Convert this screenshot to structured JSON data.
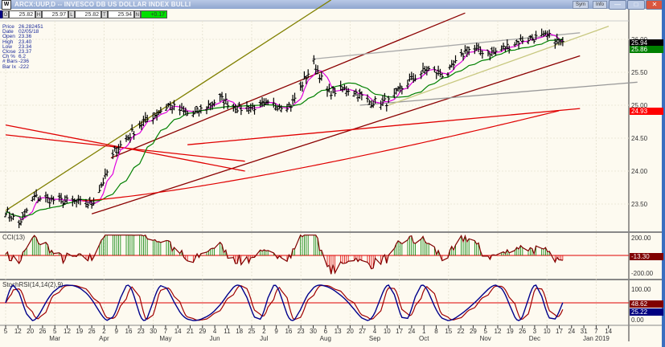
{
  "window": {
    "title": "ARCX:UUP,D -- INVESCO DB US DOLLAR INDEX BULLI",
    "buttons": {
      "sym": "Sym",
      "info": "Info",
      "minimize": "—",
      "maximize": "□",
      "close": "✕"
    }
  },
  "quote_bar": {
    "open_key": "O",
    "open": "25.82",
    "high_key": "H",
    "high": "25.97",
    "low_key": "L",
    "low": "25.82",
    "last_key": "T",
    "last": "25.94",
    "net_key": "N",
    "net": "+0.17",
    "net_color": "#00e000"
  },
  "info_box": [
    {
      "label": "Price",
      "value": "26.282451"
    },
    {
      "label": "Date",
      "value": "02/05/18"
    },
    {
      "label": "Open",
      "value": "23.36"
    },
    {
      "label": "High",
      "value": "23.40"
    },
    {
      "label": "Low",
      "value": "23.34"
    },
    {
      "label": "Close",
      "value": "23.37"
    },
    {
      "label": "Ch %",
      "value": "6.2"
    },
    {
      "label": "# Bars",
      "value": "-236"
    },
    {
      "label": "Bar Ix",
      "value": "-222"
    }
  ],
  "price_axis": {
    "ticks": [
      "26.00",
      "25.50",
      "25.00",
      "24.50",
      "24.00",
      "23.50"
    ],
    "tick_values": [
      26.0,
      25.5,
      25.0,
      24.5,
      24.0,
      23.5
    ],
    "markers": [
      {
        "value": "25.94",
        "price": 25.94,
        "color": "#000000"
      },
      {
        "value": "25.86",
        "price": 25.86,
        "color": "#008000"
      },
      {
        "value": "24.93",
        "price": 24.93,
        "color": "#ff0000"
      }
    ]
  },
  "cci": {
    "title": "CCI(13)",
    "ticks": [
      "200.00",
      "-200.00"
    ],
    "marker": {
      "value": "-13.30",
      "color": "#800000"
    }
  },
  "stochrsi": {
    "title": "StochRSI(14,14(2),9)",
    "ticks": [
      "100.00",
      "0.00"
    ],
    "markers": [
      {
        "value": "48.62",
        "color": "#800000"
      },
      {
        "value": "25.22",
        "color": "#000080"
      }
    ]
  },
  "date_axis": {
    "days": [
      "5",
      "12",
      "20",
      "26",
      "5",
      "12",
      "19",
      "26",
      "2",
      "9",
      "16",
      "23",
      "30",
      "7",
      "14",
      "21",
      "29",
      "4",
      "11",
      "18",
      "25",
      "2",
      "9",
      "16",
      "23",
      "30",
      "6",
      "13",
      "20",
      "27",
      "4",
      "10",
      "17",
      "24",
      "1",
      "8",
      "15",
      "22",
      "29",
      "5",
      "12",
      "19",
      "26",
      "3",
      "10",
      "17",
      "24",
      "31",
      "7",
      "14"
    ],
    "months": [
      {
        "label": "Mar",
        "at": 4
      },
      {
        "label": "Apr",
        "at": 8
      },
      {
        "label": "May",
        "at": 13
      },
      {
        "label": "Jun",
        "at": 17
      },
      {
        "label": "Jul",
        "at": 21
      },
      {
        "label": "Aug",
        "at": 26
      },
      {
        "label": "Sep",
        "at": 30
      },
      {
        "label": "Oct",
        "at": 34
      },
      {
        "label": "Nov",
        "at": 39
      },
      {
        "label": "Dec",
        "at": 43
      },
      {
        "label": "Jan 2019",
        "at": 48
      }
    ]
  },
  "chart_data": {
    "type": "ohlc",
    "x_unit": "days since Mar 5 2018",
    "x_range": [
      0,
      315
    ],
    "y_range": [
      23.2,
      26.1
    ],
    "price_path": [
      [
        0,
        23.4
      ],
      [
        7,
        23.2
      ],
      [
        15,
        23.6
      ],
      [
        28,
        23.55
      ],
      [
        45,
        23.5
      ],
      [
        52,
        23.9
      ],
      [
        57,
        24.3
      ],
      [
        70,
        24.7
      ],
      [
        85,
        25.0
      ],
      [
        97,
        24.85
      ],
      [
        112,
        25.1
      ],
      [
        122,
        24.95
      ],
      [
        137,
        25.0
      ],
      [
        149,
        25.0
      ],
      [
        161,
        25.65
      ],
      [
        168,
        25.2
      ],
      [
        180,
        25.25
      ],
      [
        190,
        25.05
      ],
      [
        200,
        25.05
      ],
      [
        210,
        25.35
      ],
      [
        220,
        25.55
      ],
      [
        230,
        25.45
      ],
      [
        241,
        25.85
      ],
      [
        255,
        25.8
      ],
      [
        270,
        26.0
      ],
      [
        283,
        26.05
      ],
      [
        291,
        25.92
      ]
    ],
    "trendlines": [
      {
        "color": "#8b0000",
        "pts": [
          [
            45,
            23.35
          ],
          [
            300,
            25.75
          ]
        ]
      },
      {
        "color": "#8b0000",
        "pts": [
          [
            55,
            24.2
          ],
          [
            240,
            26.4
          ]
        ]
      },
      {
        "color": "#808000",
        "pts": [
          [
            0,
            23.4
          ],
          [
            170,
            26.6
          ]
        ]
      },
      {
        "color": "#e00000",
        "pts": [
          [
            0,
            24.7
          ],
          [
            125,
            24.0
          ]
        ]
      },
      {
        "color": "#e00000",
        "pts": [
          [
            0,
            24.55
          ],
          [
            125,
            24.15
          ]
        ]
      },
      {
        "color": "#999999",
        "pts": [
          [
            185,
            25.0
          ],
          [
            330,
            25.35
          ]
        ]
      },
      {
        "color": "#aaaaaa",
        "pts": [
          [
            160,
            25.7
          ],
          [
            300,
            26.1
          ]
        ]
      },
      {
        "color": "#c8c880",
        "pts": [
          [
            200,
            25.0
          ],
          [
            315,
            26.2
          ]
        ]
      },
      {
        "color": "#e00000",
        "pts": [
          [
            95,
            24.4
          ],
          [
            300,
            24.95
          ]
        ]
      }
    ]
  }
}
